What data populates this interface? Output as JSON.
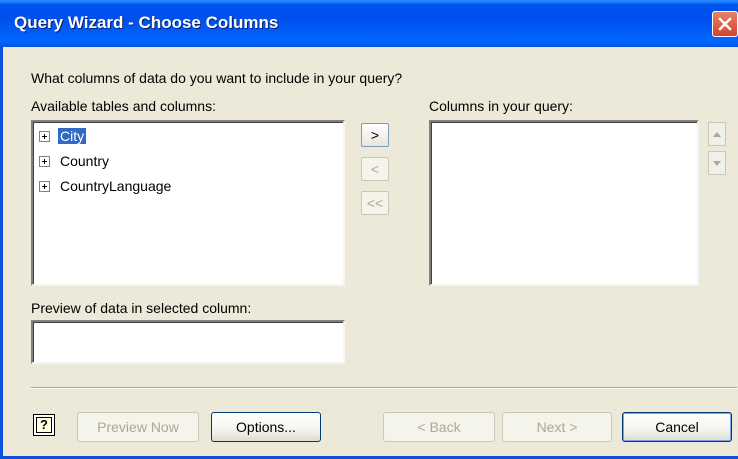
{
  "window": {
    "title": "Query Wizard - Choose Columns"
  },
  "instruction": "What columns of data do you want to include in your query?",
  "available": {
    "label": "Available tables and columns:",
    "items": [
      {
        "label": "City",
        "selected": true
      },
      {
        "label": "Country",
        "selected": false
      },
      {
        "label": "CountryLanguage",
        "selected": false
      }
    ]
  },
  "query_columns": {
    "label": "Columns in your query:"
  },
  "transfer": {
    "add": ">",
    "remove": "<",
    "remove_all": "<<"
  },
  "preview": {
    "label": "Preview of data in selected column:",
    "value": ""
  },
  "buttons": {
    "help": "?",
    "preview_now": "Preview Now",
    "options": "Options...",
    "back": "< Back",
    "next": "Next >",
    "cancel": "Cancel"
  },
  "colors": {
    "titlebar": "#0053ee",
    "selection": "#316ac5",
    "dialog_bg": "#ece9d8"
  }
}
